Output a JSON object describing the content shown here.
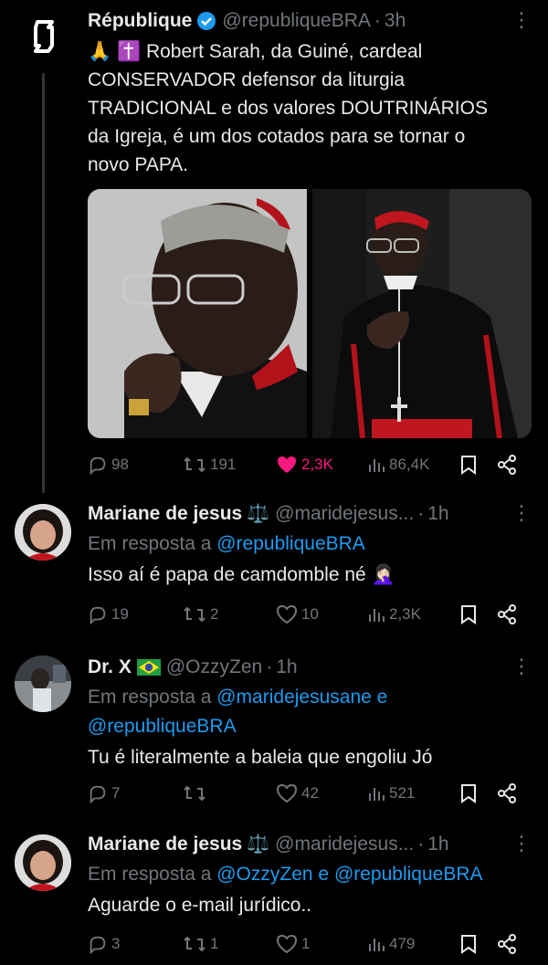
{
  "tweets": [
    {
      "name": "République",
      "handle": "@republiqueBRA",
      "time": "3h",
      "text_lines": [
        "🙏 ✝️ Robert Sarah, da Guiné, cardeal",
        "CONSERVADOR defensor da liturgia",
        "TRADICIONAL e dos valores DOUTRINÁRIOS",
        "da Igreja, é um dos cotados para se tornar o",
        "novo PAPA."
      ],
      "replies": "98",
      "reposts": "191",
      "likes": "2,3K",
      "views": "86,4K"
    },
    {
      "name": "Mariane de jesus",
      "handle": "@maridejesus...",
      "time": "1h",
      "reply_prefix": "Em resposta a ",
      "reply_to_1": "@republiqueBRA",
      "text": "Isso aí é papa de camdomble né 🤦🏻‍♀️",
      "replies": "19",
      "reposts": "2",
      "likes": "10",
      "views": "2,3K"
    },
    {
      "name": "Dr. X",
      "handle": "@OzzyZen",
      "time": "1h",
      "reply_prefix": "Em resposta a ",
      "reply_to_1": "@maridejesusane",
      "reply_joiner": " e",
      "reply_to_2": "@republiqueBRA",
      "text": "Tu é literalmente a baleia que engoliu Jó",
      "replies": "7",
      "reposts": "",
      "likes": "42",
      "views": "521"
    },
    {
      "name": "Mariane de jesus",
      "handle": "@maridejesus...",
      "time": "1h",
      "reply_prefix": "Em resposta a ",
      "reply_to_1": "@OzzyZen",
      "reply_joiner": " e ",
      "reply_to_2": "@republiqueBRA",
      "text": "Aguarde o e-mail jurídico..",
      "replies": "3",
      "reposts": "1",
      "likes": "1",
      "views": "479"
    }
  ],
  "colors": {
    "background": "#000000",
    "text": "#e7e9ea",
    "muted": "#71767b",
    "link": "#1d9bf0",
    "like": "#f91880",
    "verified": "#1d9bf0"
  },
  "icons": [
    "logo-icon",
    "verified-icon",
    "reply-icon",
    "repost-icon",
    "like-icon",
    "views-icon",
    "bookmark-icon",
    "share-icon",
    "more-icon",
    "scales-icon",
    "brazil-flag-icon"
  ]
}
